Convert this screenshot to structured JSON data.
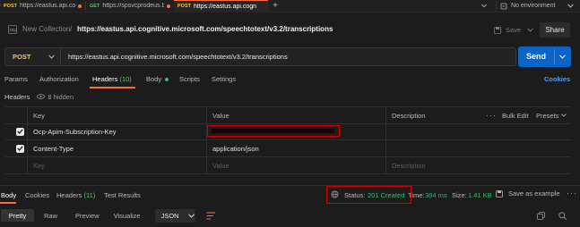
{
  "tabs": [
    {
      "method": "POST",
      "method_color": "#f2c94c",
      "label": "https://eastus.api.cogr",
      "active": false
    },
    {
      "method": "GET",
      "method_color": "#5ec26a",
      "label": "https://spsvcprodeus.bl",
      "active": false
    },
    {
      "method": "POST",
      "method_color": "#f2c94c",
      "label": "https://eastus.api.cogn",
      "active": true
    }
  ],
  "new_tab_symbol": "+",
  "environment": {
    "label": "No environment"
  },
  "breadcrumb": {
    "collection": "New Collection",
    "separator": "/",
    "request": "https://eastus.api.cognitive.microsoft.com/speechtotext/v3.2/transcriptions"
  },
  "actions": {
    "save": "Save",
    "share": "Share"
  },
  "request": {
    "method": "POST",
    "url": "https://eastus.api.cognitive.microsoft.com/speechtotext/v3.2/transcriptions",
    "send": "Send"
  },
  "request_tabs": {
    "params": "Params",
    "authorization": "Authorization",
    "headers": "Headers",
    "headers_count": "(10)",
    "body": "Body",
    "scripts": "Scripts",
    "settings": "Settings",
    "cookies": "Cookies"
  },
  "headers_bar": {
    "title": "Headers",
    "hidden": "8 hidden"
  },
  "table": {
    "columns": {
      "key": "Key",
      "value": "Value",
      "description": "Description"
    },
    "bulk_edit": "Bulk Edit",
    "presets": "Presets",
    "rows": [
      {
        "key": "Ocp-Apim-Subscription-Key",
        "value": "",
        "description": ""
      },
      {
        "key": "Content-Type",
        "value": "application/json",
        "description": ""
      }
    ],
    "placeholder": {
      "key": "Key",
      "value": "Value",
      "description": "Description"
    }
  },
  "response_tabs": {
    "body": "Body",
    "cookies": "Cookies",
    "headers": "Headers",
    "headers_count": "(11)",
    "test_results": "Test Results"
  },
  "response_meta": {
    "status_label": "Status:",
    "status_value": "201 Created",
    "time_label": "Time:",
    "time_value": "384 ms",
    "size_label": "Size:",
    "size_value": "1.41 KB",
    "save_example": "Save as example"
  },
  "view_modes": [
    "Pretty",
    "Raw",
    "Preview",
    "Visualize"
  ],
  "format": "JSON",
  "colors": {
    "accent": "#ff6c37",
    "send": "#0a64c8",
    "status_ok": "#2fbe6a",
    "post": "#f2c94c",
    "cookies_link": "#4f9cf5",
    "highlight_box": "#d40000"
  }
}
